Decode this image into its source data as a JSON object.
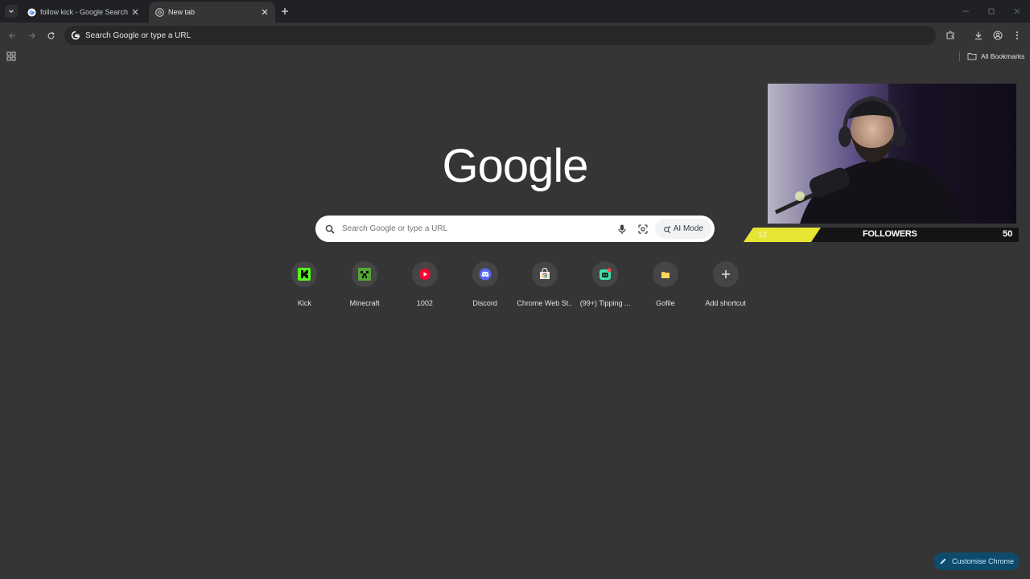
{
  "tabs": [
    {
      "title": "follow kick - Google Search",
      "active": false
    },
    {
      "title": "New tab",
      "active": true
    }
  ],
  "omnibox": {
    "text": "Search Google or type a URL"
  },
  "bookmarks": {
    "all_bookmarks_label": "All Bookmarks"
  },
  "ntp": {
    "logo_text": "Google",
    "search_placeholder": "Search Google or type a URL",
    "ai_mode_label": "AI Mode",
    "shortcuts": [
      {
        "label": "Kick",
        "icon": "kick-icon",
        "color": "#53fc18"
      },
      {
        "label": "Minecraft",
        "icon": "minecraft-icon",
        "color": "#52a535"
      },
      {
        "label": "1002",
        "icon": "youtube-icon",
        "color": "#ff0033"
      },
      {
        "label": "Discord",
        "icon": "discord-icon",
        "color": "#5865f2"
      },
      {
        "label": "Chrome Web St...",
        "icon": "chrome-web-store-icon",
        "color": "#e8eaed"
      },
      {
        "label": "(99+) Tipping ...",
        "icon": "tipping-icon",
        "color": "#3ee0b0"
      },
      {
        "label": "Gofile",
        "icon": "gofile-icon",
        "color": "#f5c542"
      },
      {
        "label": "Add shortcut",
        "icon": "plus-icon",
        "color": "#e3e3e3"
      }
    ],
    "customise_label": "Customise Chrome"
  },
  "overlay": {
    "followers_count": "12",
    "followers_label": "FOLLOWERS",
    "followers_goal": "50",
    "accent": "#e7e533"
  }
}
